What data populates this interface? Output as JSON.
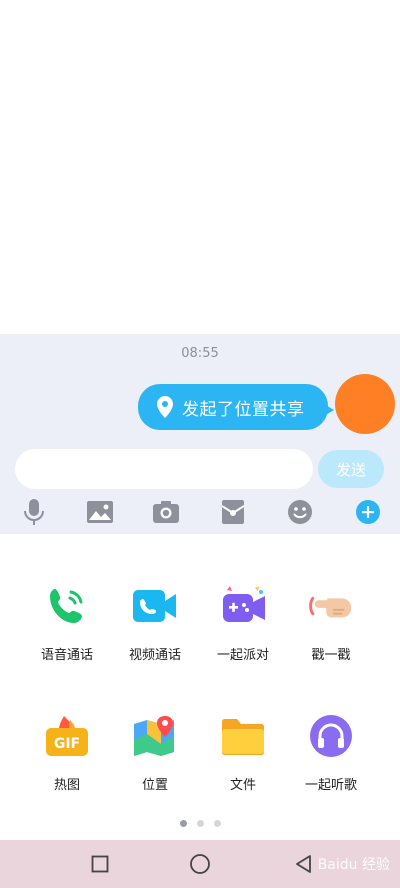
{
  "chat": {
    "time": "08:55",
    "message": "发起了位置共享",
    "input_placeholder": "",
    "send_label": "发送"
  },
  "toolbar": {
    "icons": [
      "microphone-icon",
      "image-icon",
      "camera-icon",
      "red-packet-icon",
      "emoji-icon",
      "plus-icon"
    ]
  },
  "panel": {
    "row1": [
      {
        "label": "语音通话",
        "icon": "phone-icon"
      },
      {
        "label": "视频通话",
        "icon": "video-call-icon"
      },
      {
        "label": "一起派对",
        "icon": "party-gamepad-icon"
      },
      {
        "label": "戳一戳",
        "icon": "poke-finger-icon"
      }
    ],
    "row2": [
      {
        "label": "热图",
        "icon": "gif-icon"
      },
      {
        "label": "位置",
        "icon": "map-location-icon"
      },
      {
        "label": "文件",
        "icon": "folder-icon"
      },
      {
        "label": "一起听歌",
        "icon": "headphones-icon"
      }
    ],
    "page_dots": 3,
    "active_page": 1
  },
  "navbar": {
    "watermark": "Baidu 经验"
  },
  "colors": {
    "accent": "#2bb5f2",
    "chat_bg": "#eceef8",
    "avatar": "#ff7f24",
    "nav_bg": "#ead5dd"
  }
}
